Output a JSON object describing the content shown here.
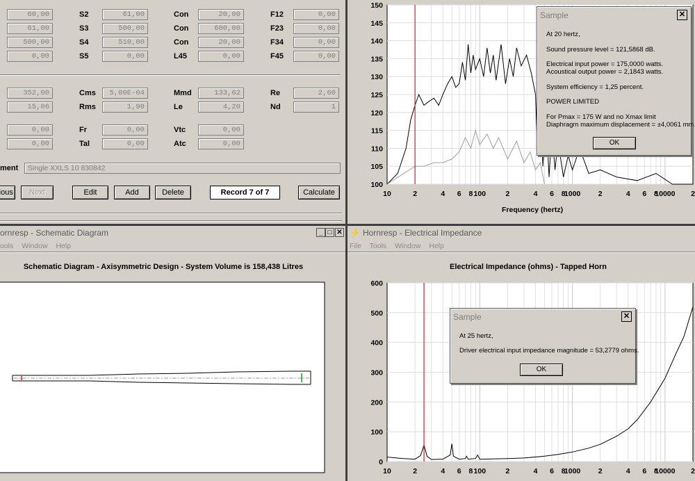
{
  "params": {
    "row1": [
      {
        "value": "60,00"
      },
      {
        "label": "S2",
        "value": "61,00"
      },
      {
        "label": "Con",
        "value": "20,00"
      },
      {
        "label": "F12",
        "value": "0,00"
      }
    ],
    "row2": [
      {
        "value": "61,00"
      },
      {
        "label": "S3",
        "value": "500,00"
      },
      {
        "label": "Con",
        "value": "600,00"
      },
      {
        "label": "F23",
        "value": "0,00"
      }
    ],
    "row3": [
      {
        "value": "500,00"
      },
      {
        "label": "S4",
        "value": "510,00"
      },
      {
        "label": "Con",
        "value": "20,00"
      },
      {
        "label": "F34",
        "value": "0,00"
      }
    ],
    "row4": [
      {
        "value": "0,00"
      },
      {
        "label": "S5",
        "value": "0,00"
      },
      {
        "label": "L45",
        "value": "0,00"
      },
      {
        "label": "F45",
        "value": "0,00"
      }
    ],
    "row5": [
      {
        "value": "352,00"
      },
      {
        "label": "Cms",
        "value": "5,00E-04"
      },
      {
        "label": "Mmd",
        "value": "133,62"
      },
      {
        "label": "Re",
        "value": "2,60"
      }
    ],
    "row6": [
      {
        "value": "15,06"
      },
      {
        "label": "Rms",
        "value": "1,90"
      },
      {
        "label": "Le",
        "value": "4,20"
      },
      {
        "label": "Nd",
        "value": "1"
      }
    ],
    "row7": [
      {
        "value": "0,00"
      },
      {
        "label": "Fr",
        "value": "0,00"
      },
      {
        "label": "Vtc",
        "value": "0,00"
      }
    ],
    "row8": [
      {
        "value": "0,00"
      },
      {
        "label": "Tal",
        "value": "0,00"
      },
      {
        "label": "Atc",
        "value": "0,00"
      }
    ],
    "comment_label": "ment",
    "comment_value": "Single XXLS 10 830842"
  },
  "buttons": {
    "previous": "vious",
    "next": "Next",
    "edit": "Edit",
    "add": "Add",
    "delete": "Delete",
    "record": "Record 7 of 7",
    "calculate": "Calculate"
  },
  "spl_chart": {
    "x_ticks": [
      "10",
      "2",
      "4",
      "6",
      "8",
      "100",
      "2",
      "4",
      "6",
      "8",
      "1000",
      "2",
      "4",
      "6",
      "8",
      "10000",
      "2"
    ],
    "y_ticks": [
      "150",
      "145",
      "140",
      "135",
      "130",
      "125",
      "120",
      "115",
      "110",
      "105",
      "100"
    ],
    "xlabel": "Frequency (hertz)"
  },
  "spl_dialog": {
    "title": "Sample",
    "lines": [
      "At 20 hertz,",
      "Sound pressure level = 121,5868 dB.",
      "Electrical input power = 175,0000 watts.",
      "Acoustical output power = 2,1843 watts.",
      "System efficiency = 1,25 percent.",
      "POWER LIMITED",
      "For Pmax = 175 W and no Xmax limit",
      "Diaphragm maximum displacement = ±4,0061 mm."
    ],
    "ok": "OK"
  },
  "schematic_window": {
    "title": "ornresp - Schematic Diagram",
    "menu": [
      "ools",
      "Window",
      "Help"
    ],
    "plot_title": "Schematic Diagram - Axisymmetric Design - System Volume is 158,438 Litres"
  },
  "impedance_window": {
    "title": "Hornresp - Electrical Impedance",
    "menu": [
      "File",
      "Tools",
      "Window",
      "Help"
    ],
    "plot_title": "Electrical Impedance (ohms) - Tapped Horn"
  },
  "imp_chart": {
    "x_ticks": [
      "10",
      "2",
      "4",
      "6",
      "8",
      "100",
      "2",
      "4",
      "6",
      "8",
      "1000",
      "2",
      "4",
      "6",
      "8",
      "10000",
      "2"
    ],
    "y_ticks": [
      "600",
      "500",
      "400",
      "300",
      "200",
      "100",
      "0"
    ]
  },
  "imp_dialog": {
    "title": "Sample",
    "lines": [
      "At 25 hertz,",
      "Driver electrical input impedance magnitude = 53,2779 ohms."
    ],
    "ok": "OK"
  },
  "chart_data": [
    {
      "type": "line",
      "x_scale": "log",
      "xlim": [
        10,
        20000
      ],
      "ylim": [
        100,
        150
      ],
      "xlabel": "Frequency (hertz)",
      "marker_x": 20,
      "series": [
        {
          "x": [
            10,
            13,
            16,
            18,
            20,
            22,
            25,
            28,
            32,
            36,
            40,
            45,
            50,
            55,
            60,
            65,
            70,
            75,
            80,
            85,
            90,
            100,
            110,
            120,
            130,
            140,
            150,
            170,
            190,
            210,
            230,
            250,
            280,
            320,
            360,
            400,
            420,
            450,
            480,
            520,
            560,
            600,
            650,
            700,
            800,
            900,
            1000,
            1200,
            1500,
            2000,
            3000,
            5000,
            8000,
            12000,
            20000
          ],
          "y": [
            100,
            103,
            110,
            118,
            122,
            125,
            122,
            123,
            124,
            122,
            125,
            128,
            130,
            127,
            128,
            134,
            129,
            139,
            131,
            136,
            132,
            135,
            130,
            138,
            131,
            136,
            129,
            139,
            128,
            135,
            130,
            138,
            133,
            136,
            131,
            125,
            110,
            128,
            105,
            120,
            102,
            115,
            104,
            112,
            102,
            108,
            104,
            110,
            103,
            104,
            102,
            101,
            103,
            100,
            100
          ]
        },
        {
          "x": [
            10,
            20,
            25,
            32,
            40,
            50,
            60,
            70,
            80,
            90,
            100,
            120,
            140,
            160,
            200,
            250,
            300,
            350,
            400,
            450,
            500
          ],
          "y": [
            100,
            105,
            105,
            106,
            106,
            107,
            109,
            113,
            110,
            115,
            111,
            114,
            110,
            113,
            107,
            112,
            106,
            109,
            104,
            106,
            100
          ]
        }
      ]
    },
    {
      "type": "line",
      "x_scale": "log",
      "xlim": [
        10,
        20000
      ],
      "ylim": [
        0,
        600
      ],
      "marker_x": 25,
      "series": [
        {
          "x": [
            10,
            15,
            20,
            23,
            25,
            27,
            30,
            40,
            48,
            50,
            52,
            60,
            70,
            72,
            75,
            90,
            95,
            100,
            150,
            200,
            300,
            500,
            700,
            1000,
            1500,
            2000,
            3000,
            4000,
            5000,
            7000,
            10000,
            13000,
            16000,
            20000
          ],
          "y": [
            15,
            10,
            8,
            20,
            55,
            18,
            7,
            8,
            22,
            60,
            18,
            8,
            10,
            18,
            8,
            10,
            22,
            8,
            9,
            10,
            12,
            18,
            24,
            32,
            45,
            58,
            85,
            110,
            140,
            200,
            280,
            360,
            420,
            520
          ]
        }
      ]
    }
  ]
}
